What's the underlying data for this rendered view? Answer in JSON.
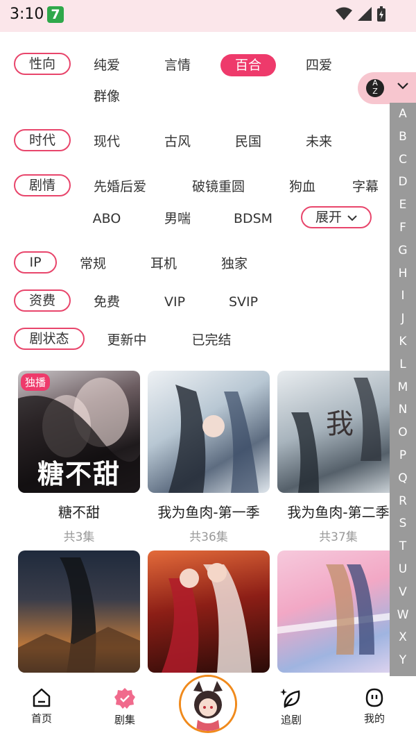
{
  "status": {
    "time": "3:10",
    "app_badge": "7"
  },
  "filters": {
    "genre": {
      "label": "性向",
      "options": [
        "纯爱",
        "言情",
        "百合",
        "四爱",
        "群像"
      ],
      "selected": "百合"
    },
    "era": {
      "label": "时代",
      "options": [
        "现代",
        "古风",
        "民国",
        "未来"
      ]
    },
    "plot": {
      "label": "剧情",
      "options": [
        "先婚后爱",
        "破镜重圆",
        "狗血",
        "字幕",
        "ABO",
        "男喘",
        "BDSM"
      ],
      "expand": "展开"
    },
    "ip": {
      "label": "IP",
      "options": [
        "常规",
        "耳机",
        "独家"
      ]
    },
    "fee": {
      "label": "资费",
      "options": [
        "免费",
        "VIP",
        "SVIP"
      ]
    },
    "state": {
      "label": "剧状态",
      "options": [
        "更新中",
        "已完结"
      ]
    }
  },
  "sort": {
    "icon": "az-sort-icon",
    "az_top": "A",
    "az_bottom": "Z"
  },
  "alphabet": [
    "A",
    "B",
    "C",
    "D",
    "E",
    "F",
    "G",
    "H",
    "I",
    "J",
    "K",
    "L",
    "M",
    "N",
    "O",
    "P",
    "Q",
    "R",
    "S",
    "T",
    "U",
    "V",
    "W",
    "X",
    "Y"
  ],
  "cards": [
    {
      "title": "糖不甜",
      "count": "共3集",
      "badge": "独播",
      "poster_text": "糖不甜"
    },
    {
      "title": "我为鱼肉-第一季",
      "count": "共36集"
    },
    {
      "title": "我为鱼肉-第二季",
      "count": "共37集"
    },
    {
      "title": "",
      "count": ""
    },
    {
      "title": "",
      "count": ""
    },
    {
      "title": "",
      "count": ""
    }
  ],
  "tabs": {
    "home": "首页",
    "series": "剧集",
    "follow": "追剧",
    "mine": "我的"
  },
  "colors": {
    "accent": "#ee3a6b",
    "status_bg": "#fbe6ea",
    "index_bar": "#9a9a9a"
  }
}
